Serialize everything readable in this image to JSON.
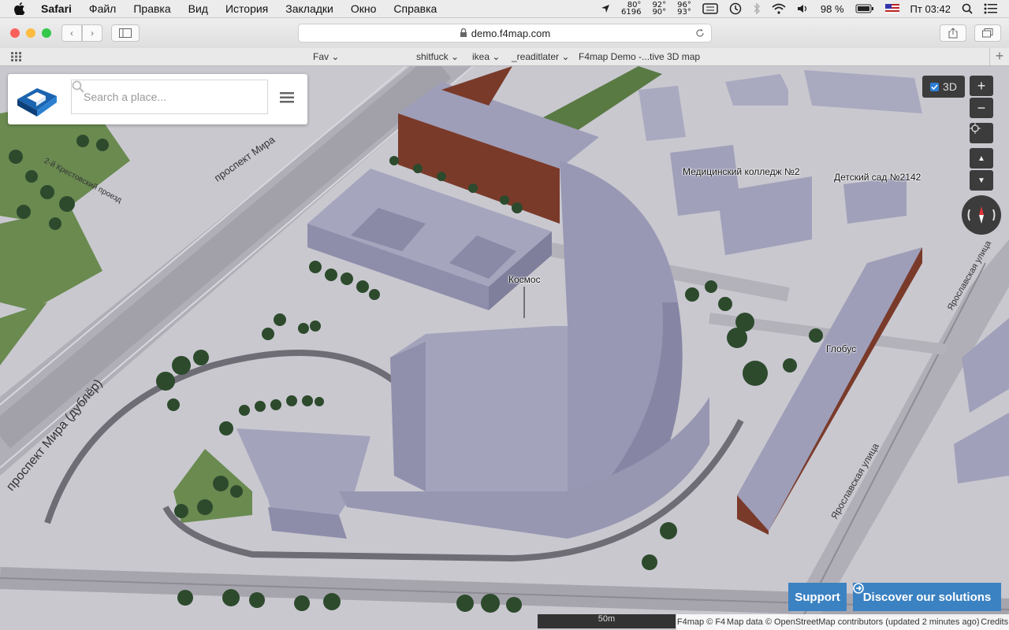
{
  "menubar": {
    "app": "Safari",
    "menus": [
      "Файл",
      "Правка",
      "Вид",
      "История",
      "Закладки",
      "Окно",
      "Справка"
    ],
    "stats": [
      [
        "80°",
        "6196"
      ],
      [
        "92°",
        "90°"
      ],
      [
        "96°",
        "93°"
      ]
    ],
    "battery": "98 %",
    "clock": "Пт 03:42"
  },
  "toolbar": {
    "url": "demo.f4map.com"
  },
  "bookmarks": [
    "Fav",
    "shitfuck",
    "ikea",
    "_readitlater",
    "F4map Demo -...tive 3D map"
  ],
  "map": {
    "search_placeholder": "Search a place...",
    "toggle_3d": "3D",
    "zoom_in": "+",
    "zoom_out": "−",
    "labels": {
      "kosmos": "Космос",
      "college": "Медицинский колледж №2",
      "kindergarten": "Детский сад №2142",
      "globus": "Глобус",
      "prospekt_mira_dubler": "проспект Мира (дублёр)",
      "prospekt_mira": "проспект Мира",
      "yaroslavskaya_1": "Ярославская улица",
      "yaroslavskaya_2": "Ярославская улица",
      "proezd": "2-й Крестовский проезд"
    },
    "support_label": "Support",
    "discover_label": "Discover our solutions",
    "scale": "50m",
    "attribution": {
      "f4": "F4map © F4",
      "osm": "Map data © OpenStreetMap contributors (updated 2 minutes ago)",
      "credits": "Credits"
    }
  },
  "colors": {
    "ground": "#c9c8cf",
    "road": "#a6a5ad",
    "building": "#9e9eb8",
    "building_dark": "#8a8aa6",
    "brick": "#7a3a2a",
    "grass": "#5a7a44",
    "tree": "#2d4a2d",
    "accent": "#3b82c2"
  }
}
